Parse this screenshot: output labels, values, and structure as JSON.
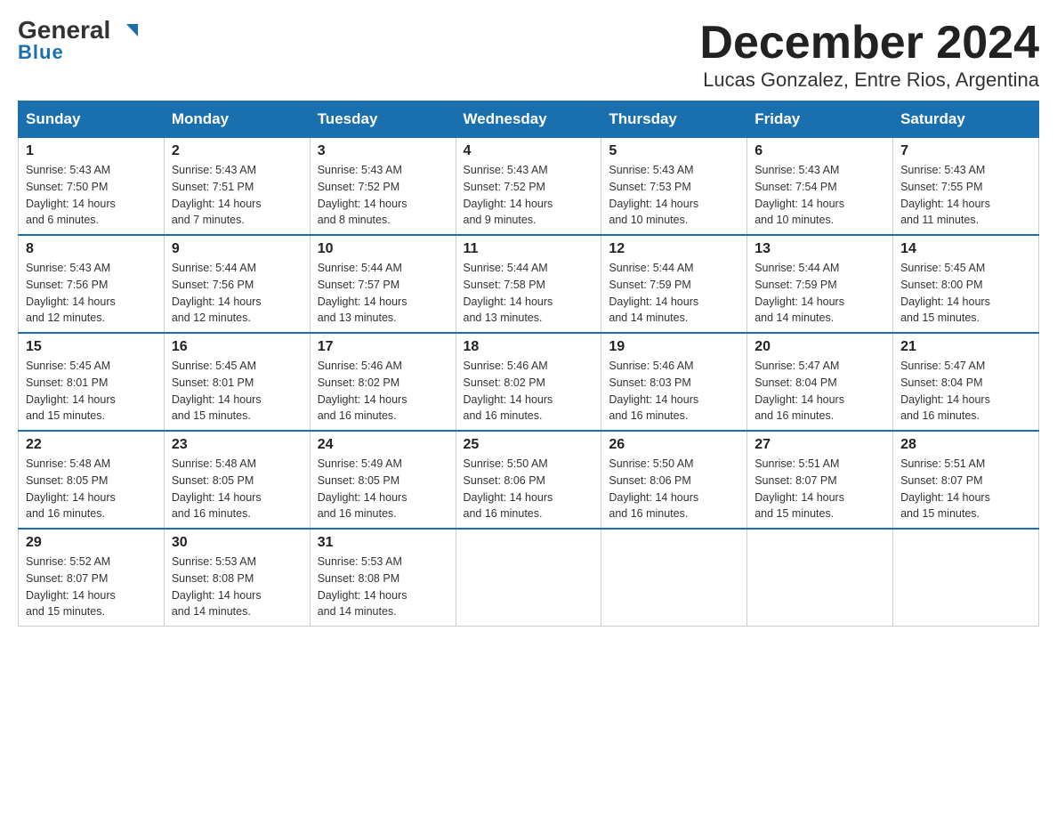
{
  "header": {
    "logo_main": "General",
    "logo_sub": "Blue",
    "month": "December 2024",
    "location": "Lucas Gonzalez, Entre Rios, Argentina"
  },
  "days_of_week": [
    "Sunday",
    "Monday",
    "Tuesday",
    "Wednesday",
    "Thursday",
    "Friday",
    "Saturday"
  ],
  "weeks": [
    [
      {
        "day": "1",
        "sunrise": "5:43 AM",
        "sunset": "7:50 PM",
        "daylight": "14 hours and 6 minutes."
      },
      {
        "day": "2",
        "sunrise": "5:43 AM",
        "sunset": "7:51 PM",
        "daylight": "14 hours and 7 minutes."
      },
      {
        "day": "3",
        "sunrise": "5:43 AM",
        "sunset": "7:52 PM",
        "daylight": "14 hours and 8 minutes."
      },
      {
        "day": "4",
        "sunrise": "5:43 AM",
        "sunset": "7:52 PM",
        "daylight": "14 hours and 9 minutes."
      },
      {
        "day": "5",
        "sunrise": "5:43 AM",
        "sunset": "7:53 PM",
        "daylight": "14 hours and 10 minutes."
      },
      {
        "day": "6",
        "sunrise": "5:43 AM",
        "sunset": "7:54 PM",
        "daylight": "14 hours and 10 minutes."
      },
      {
        "day": "7",
        "sunrise": "5:43 AM",
        "sunset": "7:55 PM",
        "daylight": "14 hours and 11 minutes."
      }
    ],
    [
      {
        "day": "8",
        "sunrise": "5:43 AM",
        "sunset": "7:56 PM",
        "daylight": "14 hours and 12 minutes."
      },
      {
        "day": "9",
        "sunrise": "5:44 AM",
        "sunset": "7:56 PM",
        "daylight": "14 hours and 12 minutes."
      },
      {
        "day": "10",
        "sunrise": "5:44 AM",
        "sunset": "7:57 PM",
        "daylight": "14 hours and 13 minutes."
      },
      {
        "day": "11",
        "sunrise": "5:44 AM",
        "sunset": "7:58 PM",
        "daylight": "14 hours and 13 minutes."
      },
      {
        "day": "12",
        "sunrise": "5:44 AM",
        "sunset": "7:59 PM",
        "daylight": "14 hours and 14 minutes."
      },
      {
        "day": "13",
        "sunrise": "5:44 AM",
        "sunset": "7:59 PM",
        "daylight": "14 hours and 14 minutes."
      },
      {
        "day": "14",
        "sunrise": "5:45 AM",
        "sunset": "8:00 PM",
        "daylight": "14 hours and 15 minutes."
      }
    ],
    [
      {
        "day": "15",
        "sunrise": "5:45 AM",
        "sunset": "8:01 PM",
        "daylight": "14 hours and 15 minutes."
      },
      {
        "day": "16",
        "sunrise": "5:45 AM",
        "sunset": "8:01 PM",
        "daylight": "14 hours and 15 minutes."
      },
      {
        "day": "17",
        "sunrise": "5:46 AM",
        "sunset": "8:02 PM",
        "daylight": "14 hours and 16 minutes."
      },
      {
        "day": "18",
        "sunrise": "5:46 AM",
        "sunset": "8:02 PM",
        "daylight": "14 hours and 16 minutes."
      },
      {
        "day": "19",
        "sunrise": "5:46 AM",
        "sunset": "8:03 PM",
        "daylight": "14 hours and 16 minutes."
      },
      {
        "day": "20",
        "sunrise": "5:47 AM",
        "sunset": "8:04 PM",
        "daylight": "14 hours and 16 minutes."
      },
      {
        "day": "21",
        "sunrise": "5:47 AM",
        "sunset": "8:04 PM",
        "daylight": "14 hours and 16 minutes."
      }
    ],
    [
      {
        "day": "22",
        "sunrise": "5:48 AM",
        "sunset": "8:05 PM",
        "daylight": "14 hours and 16 minutes."
      },
      {
        "day": "23",
        "sunrise": "5:48 AM",
        "sunset": "8:05 PM",
        "daylight": "14 hours and 16 minutes."
      },
      {
        "day": "24",
        "sunrise": "5:49 AM",
        "sunset": "8:05 PM",
        "daylight": "14 hours and 16 minutes."
      },
      {
        "day": "25",
        "sunrise": "5:50 AM",
        "sunset": "8:06 PM",
        "daylight": "14 hours and 16 minutes."
      },
      {
        "day": "26",
        "sunrise": "5:50 AM",
        "sunset": "8:06 PM",
        "daylight": "14 hours and 16 minutes."
      },
      {
        "day": "27",
        "sunrise": "5:51 AM",
        "sunset": "8:07 PM",
        "daylight": "14 hours and 15 minutes."
      },
      {
        "day": "28",
        "sunrise": "5:51 AM",
        "sunset": "8:07 PM",
        "daylight": "14 hours and 15 minutes."
      }
    ],
    [
      {
        "day": "29",
        "sunrise": "5:52 AM",
        "sunset": "8:07 PM",
        "daylight": "14 hours and 15 minutes."
      },
      {
        "day": "30",
        "sunrise": "5:53 AM",
        "sunset": "8:08 PM",
        "daylight": "14 hours and 14 minutes."
      },
      {
        "day": "31",
        "sunrise": "5:53 AM",
        "sunset": "8:08 PM",
        "daylight": "14 hours and 14 minutes."
      },
      null,
      null,
      null,
      null
    ]
  ],
  "labels": {
    "sunrise": "Sunrise:",
    "sunset": "Sunset:",
    "daylight": "Daylight:"
  }
}
